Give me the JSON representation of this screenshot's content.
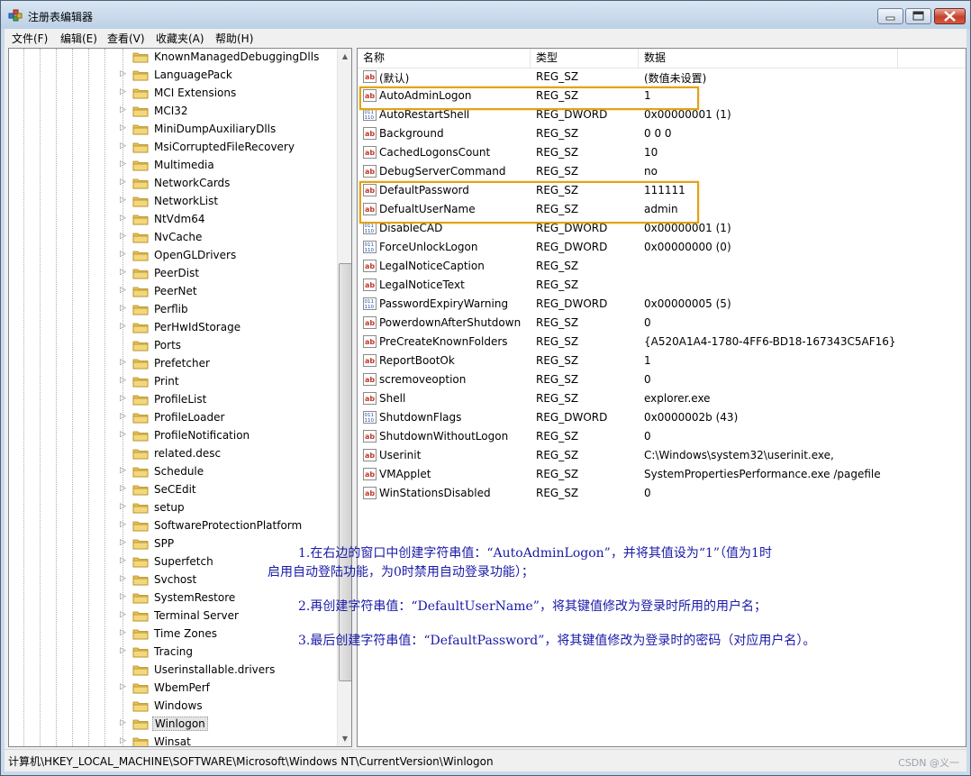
{
  "window": {
    "title": "注册表编辑器"
  },
  "menu": [
    "文件(F)",
    "编辑(E)",
    "查看(V)",
    "收藏夹(A)",
    "帮助(H)"
  ],
  "tree": {
    "selected": "Winlogon",
    "items": [
      "KnownManagedDebuggingDlls",
      "LanguagePack",
      "MCI Extensions",
      "MCI32",
      "MiniDumpAuxiliaryDlls",
      "MsiCorruptedFileRecovery",
      "Multimedia",
      "NetworkCards",
      "NetworkList",
      "NtVdm64",
      "NvCache",
      "OpenGLDrivers",
      "PeerDist",
      "PeerNet",
      "Perflib",
      "PerHwIdStorage",
      "Ports",
      "Prefetcher",
      "Print",
      "ProfileList",
      "ProfileLoader",
      "ProfileNotification",
      "related.desc",
      "Schedule",
      "SeCEdit",
      "setup",
      "SoftwareProtectionPlatform",
      "SPP",
      "Superfetch",
      "Svchost",
      "SystemRestore",
      "Terminal Server",
      "Time Zones",
      "Tracing",
      "Userinstallable.drivers",
      "WbemPerf",
      "Windows",
      "Winlogon",
      "Winsat"
    ],
    "expandable": [
      false,
      true,
      true,
      true,
      true,
      true,
      true,
      true,
      true,
      true,
      true,
      true,
      true,
      true,
      true,
      true,
      false,
      true,
      true,
      true,
      true,
      true,
      false,
      true,
      true,
      true,
      true,
      true,
      true,
      true,
      true,
      true,
      true,
      true,
      false,
      true,
      false,
      true,
      true
    ]
  },
  "list": {
    "headers": {
      "name": "名称",
      "type": "类型",
      "data": "数据"
    },
    "rows": [
      {
        "icon": "string-value-icon",
        "name": "(默认)",
        "type": "REG_SZ",
        "data": "(数值未设置)"
      },
      {
        "icon": "string-value-icon",
        "name": "AutoAdminLogon",
        "type": "REG_SZ",
        "data": "1"
      },
      {
        "icon": "binary-value-icon",
        "name": "AutoRestartShell",
        "type": "REG_DWORD",
        "data": "0x00000001 (1)"
      },
      {
        "icon": "string-value-icon",
        "name": "Background",
        "type": "REG_SZ",
        "data": "0 0 0"
      },
      {
        "icon": "string-value-icon",
        "name": "CachedLogonsCount",
        "type": "REG_SZ",
        "data": "10"
      },
      {
        "icon": "string-value-icon",
        "name": "DebugServerCommand",
        "type": "REG_SZ",
        "data": "no"
      },
      {
        "icon": "string-value-icon",
        "name": "DefaultPassword",
        "type": "REG_SZ",
        "data": "111111"
      },
      {
        "icon": "string-value-icon",
        "name": "DefualtUserName",
        "type": "REG_SZ",
        "data": "admin"
      },
      {
        "icon": "binary-value-icon",
        "name": "DisableCAD",
        "type": "REG_DWORD",
        "data": "0x00000001 (1)"
      },
      {
        "icon": "binary-value-icon",
        "name": "ForceUnlockLogon",
        "type": "REG_DWORD",
        "data": "0x00000000 (0)"
      },
      {
        "icon": "string-value-icon",
        "name": "LegalNoticeCaption",
        "type": "REG_SZ",
        "data": ""
      },
      {
        "icon": "string-value-icon",
        "name": "LegalNoticeText",
        "type": "REG_SZ",
        "data": ""
      },
      {
        "icon": "binary-value-icon",
        "name": "PasswordExpiryWarning",
        "type": "REG_DWORD",
        "data": "0x00000005 (5)"
      },
      {
        "icon": "string-value-icon",
        "name": "PowerdownAfterShutdown",
        "type": "REG_SZ",
        "data": "0"
      },
      {
        "icon": "string-value-icon",
        "name": "PreCreateKnownFolders",
        "type": "REG_SZ",
        "data": "{A520A1A4-1780-4FF6-BD18-167343C5AF16}"
      },
      {
        "icon": "string-value-icon",
        "name": "ReportBootOk",
        "type": "REG_SZ",
        "data": "1"
      },
      {
        "icon": "string-value-icon",
        "name": "scremoveoption",
        "type": "REG_SZ",
        "data": "0"
      },
      {
        "icon": "string-value-icon",
        "name": "Shell",
        "type": "REG_SZ",
        "data": "explorer.exe"
      },
      {
        "icon": "binary-value-icon",
        "name": "ShutdownFlags",
        "type": "REG_DWORD",
        "data": "0x0000002b (43)"
      },
      {
        "icon": "string-value-icon",
        "name": "ShutdownWithoutLogon",
        "type": "REG_SZ",
        "data": "0"
      },
      {
        "icon": "string-value-icon",
        "name": "Userinit",
        "type": "REG_SZ",
        "data": "C:\\Windows\\system32\\userinit.exe,"
      },
      {
        "icon": "string-value-icon",
        "name": "VMApplet",
        "type": "REG_SZ",
        "data": "SystemPropertiesPerformance.exe /pagefile"
      },
      {
        "icon": "string-value-icon",
        "name": "WinStationsDisabled",
        "type": "REG_SZ",
        "data": "0"
      }
    ]
  },
  "annotations": {
    "step1_line1": "1.在右边的窗口中创建字符串值：“AutoAdminLogon”，并将其值设为“1”（值为1时",
    "step1_line2": "启用自动登陆功能，为0时禁用自动登录功能）；",
    "step2": "2.再创建字符串值：“DefaultUserName”，将其键值修改为登录时所用的用户名；",
    "step3": "3.最后创建字符串值：“DefaultPassword”，将其键值修改为登录时的密码（对应用户名）。"
  },
  "status": {
    "path": "计算机\\HKEY_LOCAL_MACHINE\\SOFTWARE\\Microsoft\\Windows NT\\CurrentVersion\\Winlogon",
    "watermark": "CSDN @义一"
  },
  "colors": {
    "highlight_box": "#e3a21a",
    "annotation_text": "#1a1aa8",
    "folder": "#e8c35a"
  }
}
